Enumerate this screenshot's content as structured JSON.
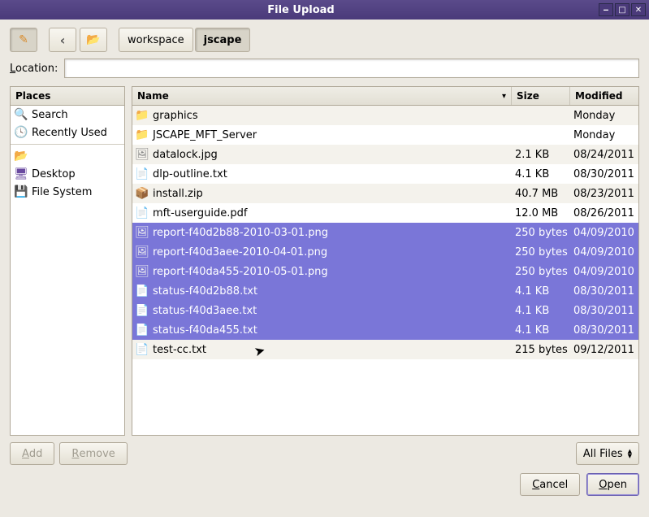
{
  "window": {
    "title": "File Upload"
  },
  "toolbar": {
    "path_segments": [
      {
        "label": "workspace",
        "active": false
      },
      {
        "label": "jscape",
        "active": true
      }
    ]
  },
  "location": {
    "label": "Location:",
    "value": ""
  },
  "places": {
    "header": "Places",
    "items": [
      {
        "icon": "search",
        "label": "Search"
      },
      {
        "icon": "recent",
        "label": "Recently Used"
      },
      {
        "sep": true
      },
      {
        "icon": "folder-c",
        "label": ""
      },
      {
        "icon": "desktop",
        "label": "Desktop"
      },
      {
        "icon": "drive",
        "label": "File System"
      }
    ]
  },
  "files": {
    "headers": {
      "name": "Name",
      "size": "Size",
      "modified": "Modified"
    },
    "rows": [
      {
        "icon": "folder",
        "name": "graphics",
        "size": "",
        "modified": "Monday",
        "selected": false
      },
      {
        "icon": "folder",
        "name": "JSCAPE_MFT_Server",
        "size": "",
        "modified": "Monday",
        "selected": false
      },
      {
        "icon": "file",
        "name": "datalock.jpg",
        "size": "2.1 KB",
        "modified": "08/24/2011",
        "selected": false
      },
      {
        "icon": "txt",
        "name": "dlp-outline.txt",
        "size": "4.1 KB",
        "modified": "08/30/2011",
        "selected": false
      },
      {
        "icon": "zip",
        "name": "install.zip",
        "size": "40.7 MB",
        "modified": "08/23/2011",
        "selected": false
      },
      {
        "icon": "pdf",
        "name": "mft-userguide.pdf",
        "size": "12.0 MB",
        "modified": "08/26/2011",
        "selected": false
      },
      {
        "icon": "img",
        "name": "report-f40d2b88-2010-03-01.png",
        "size": "250 bytes",
        "modified": "04/09/2010",
        "selected": true
      },
      {
        "icon": "img",
        "name": "report-f40d3aee-2010-04-01.png",
        "size": "250 bytes",
        "modified": "04/09/2010",
        "selected": true
      },
      {
        "icon": "img",
        "name": "report-f40da455-2010-05-01.png",
        "size": "250 bytes",
        "modified": "04/09/2010",
        "selected": true
      },
      {
        "icon": "txt",
        "name": "status-f40d2b88.txt",
        "size": "4.1 KB",
        "modified": "08/30/2011",
        "selected": true
      },
      {
        "icon": "txt",
        "name": "status-f40d3aee.txt",
        "size": "4.1 KB",
        "modified": "08/30/2011",
        "selected": true
      },
      {
        "icon": "txt",
        "name": "status-f40da455.txt",
        "size": "4.1 KB",
        "modified": "08/30/2011",
        "selected": true
      },
      {
        "icon": "txt",
        "name": "test-cc.txt",
        "size": "215 bytes",
        "modified": "09/12/2011",
        "selected": false
      }
    ]
  },
  "footer": {
    "add": "Add",
    "remove": "Remove",
    "filter": "All Files",
    "cancel": "Cancel",
    "open": "Open"
  },
  "icons": {
    "folder": "📁",
    "folder-c": "📂",
    "file": "🖼",
    "txt": "📄",
    "img": "🖼",
    "zip": "📦",
    "pdf": "📄",
    "search": "🔍",
    "recent": "🕓",
    "desktop": "🖥",
    "drive": "💾",
    "edit": "✎",
    "back": "‹"
  }
}
